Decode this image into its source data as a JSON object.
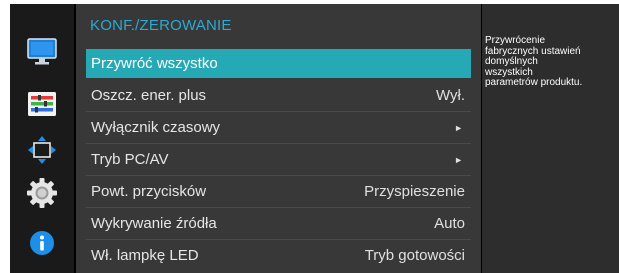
{
  "sidebar": {
    "icons": [
      {
        "name": "monitor-icon"
      },
      {
        "name": "color-adjust-icon"
      },
      {
        "name": "move-arrows-icon"
      },
      {
        "name": "settings-gear-icon"
      },
      {
        "name": "info-icon"
      }
    ]
  },
  "menu": {
    "title": "KONF./ZEROWANIE",
    "items": [
      {
        "label": "Przywróć wszystko",
        "value": "",
        "selected": true
      },
      {
        "label": "Oszcz. ener. plus",
        "value": "Wył."
      },
      {
        "label": "Wyłącznik czasowy",
        "value": "",
        "submenu": true
      },
      {
        "label": "Tryb PC/AV",
        "value": "",
        "submenu": true
      },
      {
        "label": "Powt. przycisków",
        "value": "Przyspieszenie"
      },
      {
        "label": "Wykrywanie źródła",
        "value": "Auto"
      },
      {
        "label": "Wł. lampkę LED",
        "value": "Tryb gotowości"
      }
    ],
    "submenu_arrow": "►"
  },
  "help": {
    "text": "Przywrócenie\nfabrycznych ustawień\ndomyślnych\nwszystkich\nparametrów produktu."
  },
  "colors": {
    "accent_title": "#2aaad4",
    "selected_bg": "#25a9b5",
    "menu_bg": "#383838",
    "help_bg": "#2d2d2d"
  }
}
